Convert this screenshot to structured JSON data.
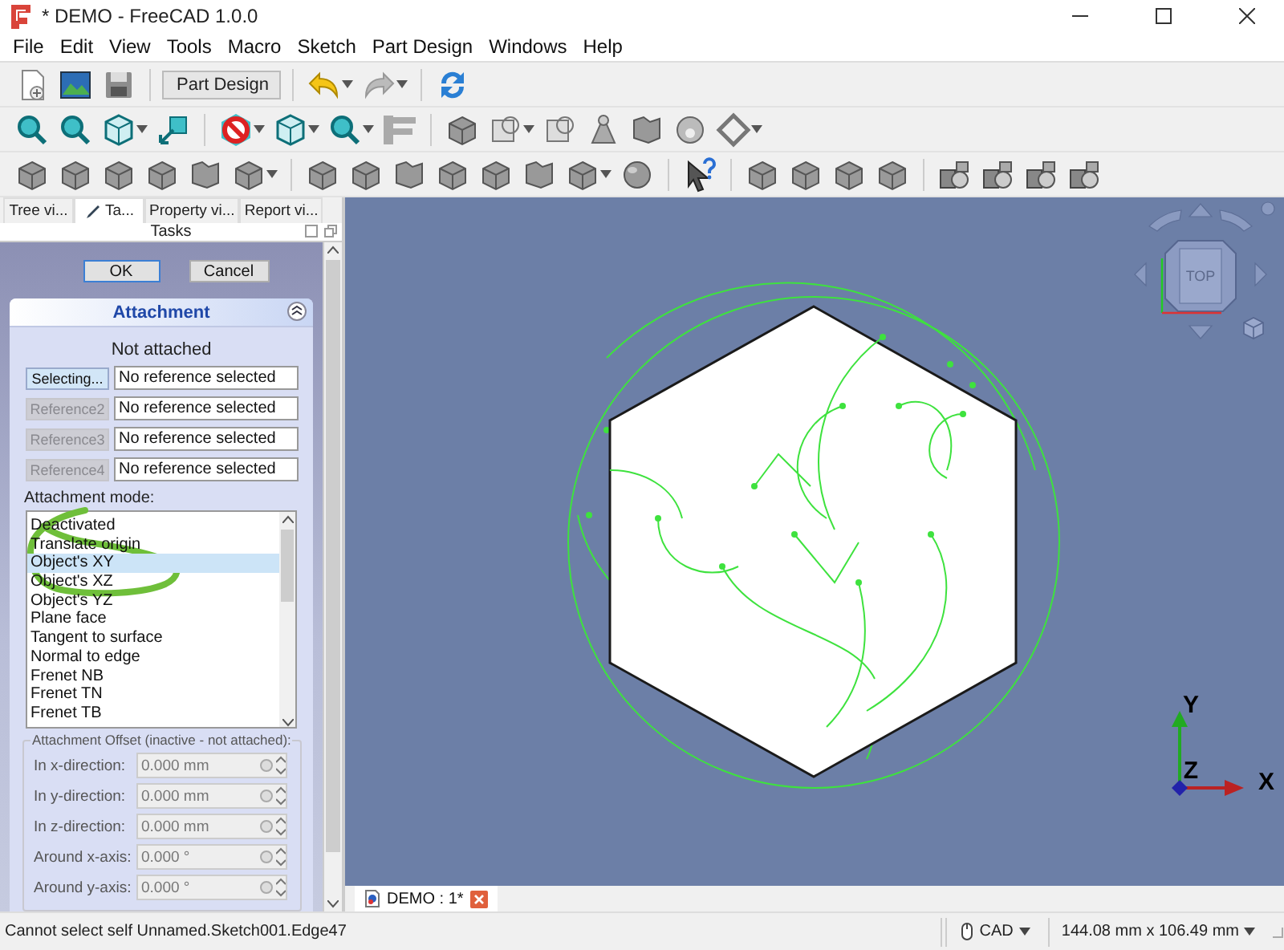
{
  "window": {
    "title": "* DEMO - FreeCAD 1.0.0"
  },
  "menu": [
    "File",
    "Edit",
    "View",
    "Tools",
    "Macro",
    "Sketch",
    "Part Design",
    "Windows",
    "Help"
  ],
  "toolbar": {
    "workbench": "Part Design"
  },
  "panel_tabs": [
    {
      "label": "Tree vi...",
      "selected": false
    },
    {
      "label": "Ta...",
      "selected": true
    },
    {
      "label": "Property vi...",
      "selected": false
    },
    {
      "label": "Report vi...",
      "selected": false
    }
  ],
  "tasks": {
    "title": "Tasks",
    "buttons": [
      "OK",
      "Cancel"
    ],
    "attachment": {
      "title": "Attachment",
      "status": "Not attached",
      "references": [
        {
          "button": "Selecting...",
          "value": "No reference selected",
          "disabled": false
        },
        {
          "button": "Reference2",
          "value": "No reference selected",
          "disabled": true
        },
        {
          "button": "Reference3",
          "value": "No reference selected",
          "disabled": true
        },
        {
          "button": "Reference4",
          "value": "No reference selected",
          "disabled": true
        }
      ],
      "mode_label": "Attachment mode:",
      "modes": [
        {
          "label": "Deactivated",
          "selected": false
        },
        {
          "label": "Translate origin",
          "selected": false
        },
        {
          "label": "Object's XY",
          "selected": true
        },
        {
          "label": "Object's XZ",
          "selected": false
        },
        {
          "label": "Object's YZ",
          "selected": false
        },
        {
          "label": "Plane face",
          "selected": false
        },
        {
          "label": "Tangent to surface",
          "selected": false
        },
        {
          "label": "Normal to edge",
          "selected": false
        },
        {
          "label": "Frenet NB",
          "selected": false
        },
        {
          "label": "Frenet TN",
          "selected": false
        },
        {
          "label": "Frenet TB",
          "selected": false
        }
      ],
      "offset": {
        "title": "Attachment Offset (inactive - not attached):",
        "disabled": true,
        "fields": [
          {
            "label": "In x-direction:",
            "value": "0.000 mm"
          },
          {
            "label": "In y-direction:",
            "value": "0.000 mm"
          },
          {
            "label": "In z-direction:",
            "value": "0.000 mm"
          },
          {
            "label": "Around x-axis:",
            "value": "0.000 °"
          },
          {
            "label": "Around y-axis:",
            "value": "0.000 °"
          }
        ]
      }
    }
  },
  "view": {
    "navcube_face": "TOP",
    "axes": {
      "y": "Y",
      "z": "Z",
      "x": "X"
    }
  },
  "document_tabs": [
    {
      "label": "DEMO : 1*",
      "selected": true
    }
  ],
  "status_bar": {
    "message": "Cannot select self Unnamed.Sketch001.Edge47",
    "navigation": "CAD",
    "dimensions": "144.08 mm x 106.49 mm"
  }
}
